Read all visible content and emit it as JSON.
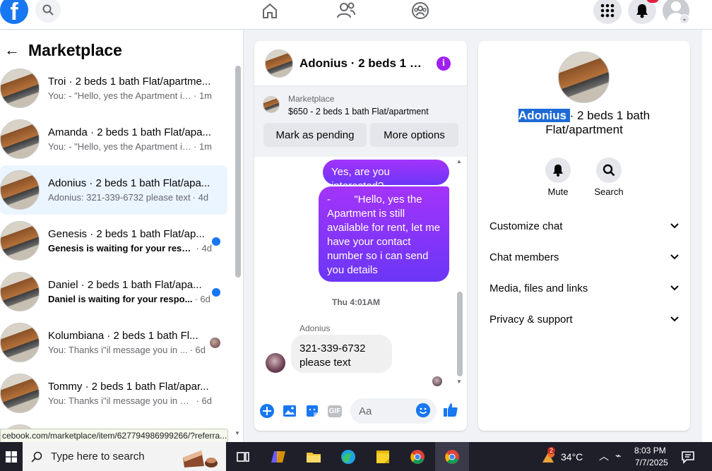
{
  "nav": {
    "logo": "f"
  },
  "left": {
    "title": "Marketplace",
    "conversations": [
      {
        "name": "Troi · 2 beds 1 bath Flat/apartme...",
        "snippet": "You: - \"Hello, yes the Apartment is ...",
        "time": "· 1m",
        "unread": false,
        "active": false
      },
      {
        "name": "Amanda · 2 beds 1 bath Flat/apa...",
        "snippet": "You: - \"Hello, yes the Apartment is ...",
        "time": "· 1m",
        "unread": false,
        "active": false
      },
      {
        "name": "Adonius · 2 beds 1 bath Flat/apa...",
        "snippet": "Adonius: 321-339-6732 please text",
        "time": "· 4d",
        "unread": false,
        "active": true
      },
      {
        "name": "Genesis · 2 beds 1 bath Flat/ap...",
        "snippet": "Genesis is waiting for your resp...",
        "time": "· 4d",
        "unread": true,
        "active": false
      },
      {
        "name": "Daniel · 2 beds 1 bath Flat/apa...",
        "snippet": "Daniel is waiting for your respo...",
        "time": "· 6d",
        "unread": true,
        "active": false
      },
      {
        "name": "Kolumbiana · 2 beds 1 bath Fl...",
        "snippet": "You: Thanks i\"il message you in ...",
        "time": "· 6d",
        "unread": false,
        "active": false
      },
      {
        "name": "Tommy · 2 beds 1 bath Flat/apar...",
        "snippet": "You: Thanks i\"il message you in a ...",
        "time": "· 6d",
        "unread": false,
        "active": false
      }
    ],
    "status_url": "cebook.com/marketplace/item/627794986999266/?referra..."
  },
  "chat": {
    "title": "Adonius · 2 beds 1 ba...",
    "marketplace_label": "Marketplace",
    "listing": "$650 - 2 beds 1 bath Flat/apartment",
    "btn_pending": "Mark as pending",
    "btn_more": "More options",
    "msg_out_1": "Yes, are you interested?",
    "msg_out_2_lines": [
      "-        \"Hello, yes the",
      "Apartment is still",
      "available for rent, let me",
      "have your contact",
      "number so i can send",
      "you details"
    ],
    "timestamp": "Thu 4:01AM",
    "sender": "Adonius",
    "msg_in_lines": [
      "321-339-6732",
      "please text"
    ],
    "input_placeholder": "Aa",
    "gif_label": "GIF"
  },
  "right": {
    "title_highlight": "Adonius ",
    "title_rest_1": "· 2 beds 1 bath",
    "title_rest_2": "Flat/apartment",
    "mute_label": "Mute",
    "search_label": "Search",
    "sections": [
      "Customize chat",
      "Chat members",
      "Media, files and links",
      "Privacy & support"
    ]
  },
  "taskbar": {
    "search_placeholder": "Type here to search",
    "weather": "34°C",
    "weather_badge": "2",
    "time": "8:03 PM",
    "date": "7/7/2025"
  },
  "colors": {
    "brand": "#1877f2",
    "bubble_start": "#a334fa",
    "bubble_end": "#6b36f7",
    "unread": "#1877f2"
  }
}
